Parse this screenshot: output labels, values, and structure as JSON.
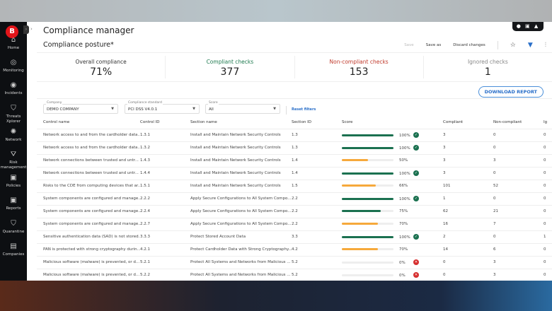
{
  "sidebar": {
    "logo": "B",
    "items": [
      {
        "label": "Home",
        "icon": "home-icon",
        "glyph": "⌂"
      },
      {
        "label": "Monitoring",
        "icon": "monitoring-icon",
        "glyph": "◎"
      },
      {
        "label": "Incidents",
        "icon": "incidents-icon",
        "glyph": "◉"
      },
      {
        "label": "Threats Xplorer",
        "icon": "shield-icon",
        "glyph": "⛉"
      },
      {
        "label": "Network",
        "icon": "network-icon",
        "glyph": "✺"
      },
      {
        "label": "Risk management",
        "icon": "risk-icon",
        "glyph": "⛛"
      },
      {
        "label": "Policies",
        "icon": "policies-icon",
        "glyph": "▣"
      },
      {
        "label": "Reports",
        "icon": "reports-icon",
        "glyph": "▣"
      },
      {
        "label": "Quarantine",
        "icon": "quarantine-icon",
        "glyph": "⛉"
      },
      {
        "label": "Companies",
        "icon": "briefcase-icon",
        "glyph": "▤"
      }
    ]
  },
  "header": {
    "title": "Compliance manager",
    "top_icons": "● ▣ ▲"
  },
  "posture": {
    "title": "Compliance posture*",
    "save": "Save",
    "save_as": "Save as",
    "discard": "Discard changes"
  },
  "cards": [
    {
      "label": "Overall compliance",
      "value": "71%",
      "color": "#333333"
    },
    {
      "label": "Compliant checks",
      "value": "377",
      "color": "#1e7a4f"
    },
    {
      "label": "Non-compliant checks",
      "value": "153",
      "color": "#c0392b"
    },
    {
      "label": "Ignored checks",
      "value": "1",
      "color": "#888888"
    }
  ],
  "download": "DOWNLOAD REPORT",
  "filters": {
    "company": {
      "label": "Company",
      "value": "DEMO COMPANY"
    },
    "standard": {
      "label": "Compliance standard",
      "value": "PCI DSS V4.0.1"
    },
    "score": {
      "label": "Score",
      "value": "All"
    },
    "reset": "Reset filters"
  },
  "colors": {
    "green": "#1b7150",
    "orange": "#f6a93b",
    "ok": "#1b7150",
    "fail": "#d62f2f"
  },
  "table": {
    "headers": [
      "Control name",
      "Control ID",
      "Section name",
      "Section ID",
      "Score",
      "Compliant",
      "Non-compliant",
      "Ig"
    ],
    "rows": [
      [
        "Network access to and from the cardholder data...",
        "1.3.1",
        "Install and Maintain Network Security Controls",
        "1.3",
        100,
        "3",
        "0",
        "0"
      ],
      [
        "Network access to and from the cardholder data...",
        "1.3.2",
        "Install and Maintain Network Security Controls",
        "1.3",
        100,
        "3",
        "0",
        "0"
      ],
      [
        "Network connections between trusted and untr...",
        "1.4.3",
        "Install and Maintain Network Security Controls",
        "1.4",
        50,
        "3",
        "3",
        "0"
      ],
      [
        "Network connections between trusted and untr...",
        "1.4.4",
        "Install and Maintain Network Security Controls",
        "1.4",
        100,
        "3",
        "0",
        "0"
      ],
      [
        "Risks to the CDE from computing devices that ar...",
        "1.5.1",
        "Install and Maintain Network Security Controls",
        "1.5",
        66,
        "101",
        "52",
        "0"
      ],
      [
        "System components are configured and manage...",
        "2.2.2",
        "Apply Secure Configurations to All System Compo...",
        "2.2",
        100,
        "1",
        "0",
        "0"
      ],
      [
        "System components are configured and manage...",
        "2.2.4",
        "Apply Secure Configurations to All System Compo...",
        "2.2",
        75,
        "62",
        "21",
        "0"
      ],
      [
        "System components are configured and manage...",
        "2.2.7",
        "Apply Secure Configurations to All System Compo...",
        "2.2",
        70,
        "16",
        "7",
        "0"
      ],
      [
        "Sensitive authentication data (SAD) is not stored...",
        "3.3.3",
        "Protect Stored Account Data",
        "3.3",
        100,
        "2",
        "0",
        "1"
      ],
      [
        "PAN is protected with strong cryptography durin...",
        "4.2.1",
        "Protect Cardholder Data with Strong Cryptography...",
        "4.2",
        70,
        "14",
        "6",
        "0"
      ],
      [
        "Malicious software (malware) is prevented, or d...",
        "5.2.1",
        "Protect All Systems and Networks from Malicious ...",
        "5.2",
        0,
        "0",
        "3",
        "0"
      ],
      [
        "Malicious software (malware) is prevented, or d...",
        "5.2.2",
        "Protect All Systems and Networks from Malicious ...",
        "5.2",
        0,
        "0",
        "3",
        "0"
      ]
    ]
  }
}
